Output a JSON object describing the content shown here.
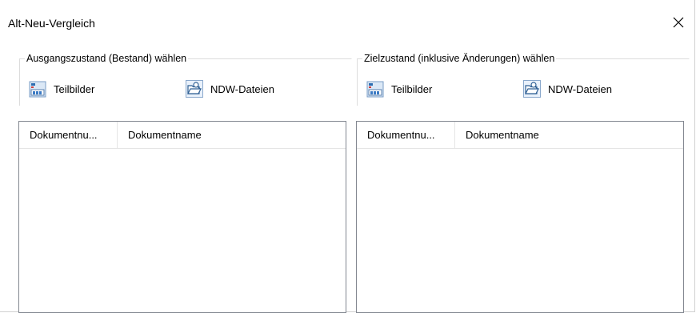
{
  "dialog": {
    "title": "Alt-Neu-Vergleich",
    "close_icon": "close-icon"
  },
  "left_group": {
    "legend": "Ausgangszustand (Bestand) wählen",
    "teilbilder_label": "Teilbilder",
    "ndw_label": "NDW-Dateien",
    "list": {
      "columns": [
        "Dokumentnu...",
        "Dokumentname"
      ],
      "rows": []
    }
  },
  "right_group": {
    "legend": "Zielzustand (inklusive Änderungen) wählen",
    "teilbilder_label": "Teilbilder",
    "ndw_label": "NDW-Dateien",
    "list": {
      "columns": [
        "Dokumentnu...",
        "Dokumentname"
      ],
      "rows": []
    }
  },
  "icons": {
    "teilbilder": "layers-icon",
    "ndw": "open-folder-icon"
  },
  "colors": {
    "list_border": "#828790",
    "header_divider": "#e5e5e5"
  }
}
